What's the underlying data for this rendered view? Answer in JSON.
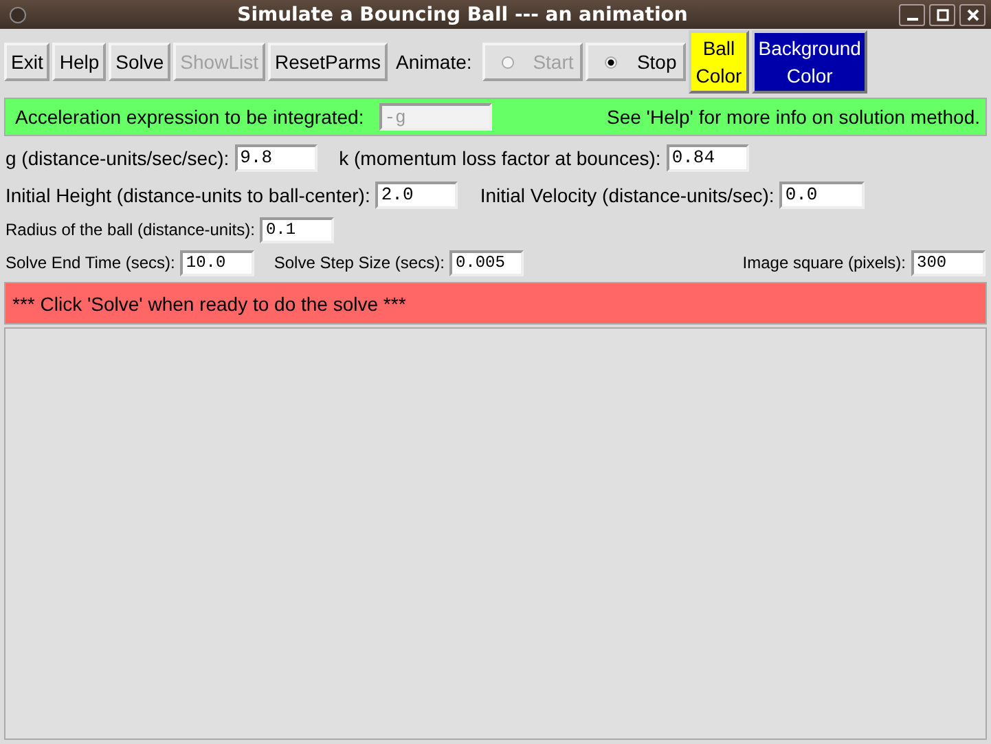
{
  "window": {
    "title": "Simulate a Bouncing Ball --- an animation"
  },
  "toolbar": {
    "buttons": [
      {
        "label": "Exit",
        "disabled": false
      },
      {
        "label": "Help",
        "disabled": false
      },
      {
        "label": "Solve",
        "disabled": false
      },
      {
        "label": "ShowList",
        "disabled": true
      },
      {
        "label": "ResetParms",
        "disabled": false
      }
    ],
    "animate_label": "Animate:",
    "radios": [
      {
        "label": "Start",
        "selected": false,
        "disabled": true
      },
      {
        "label": "Stop",
        "selected": true,
        "disabled": false
      }
    ],
    "color_buttons": [
      {
        "lines": [
          "Ball",
          "Color"
        ],
        "color": "#ffff00"
      },
      {
        "lines": [
          "Background",
          "Color"
        ],
        "color": "#0000aa"
      }
    ]
  },
  "expression": {
    "label": "Acceleration expression to be integrated:",
    "value": "-g",
    "disabled": true,
    "help": "See 'Help' for more info on solution method."
  },
  "params": [
    [
      {
        "label": "g (distance-units/sec/sec):",
        "value": "9.8"
      },
      {
        "label": "k (momentum loss factor at bounces):",
        "value": "0.84"
      }
    ],
    [
      {
        "label": "Initial Height (distance-units to ball-center):",
        "value": "2.0"
      },
      {
        "label": "Initial Velocity (distance-units/sec):",
        "value": "0.0"
      }
    ]
  ],
  "small_params": [
    [
      {
        "label": "Radius of the ball (distance-units):",
        "value": "0.1"
      }
    ],
    [
      {
        "label": "Solve End Time (secs):",
        "value": "10.0"
      },
      {
        "label": "Solve Step Size (secs):",
        "value": "0.005"
      },
      {
        "label": "Image square (pixels):",
        "value": "300"
      }
    ]
  ],
  "status": "*** Click 'Solve' when ready to do the solve ***"
}
